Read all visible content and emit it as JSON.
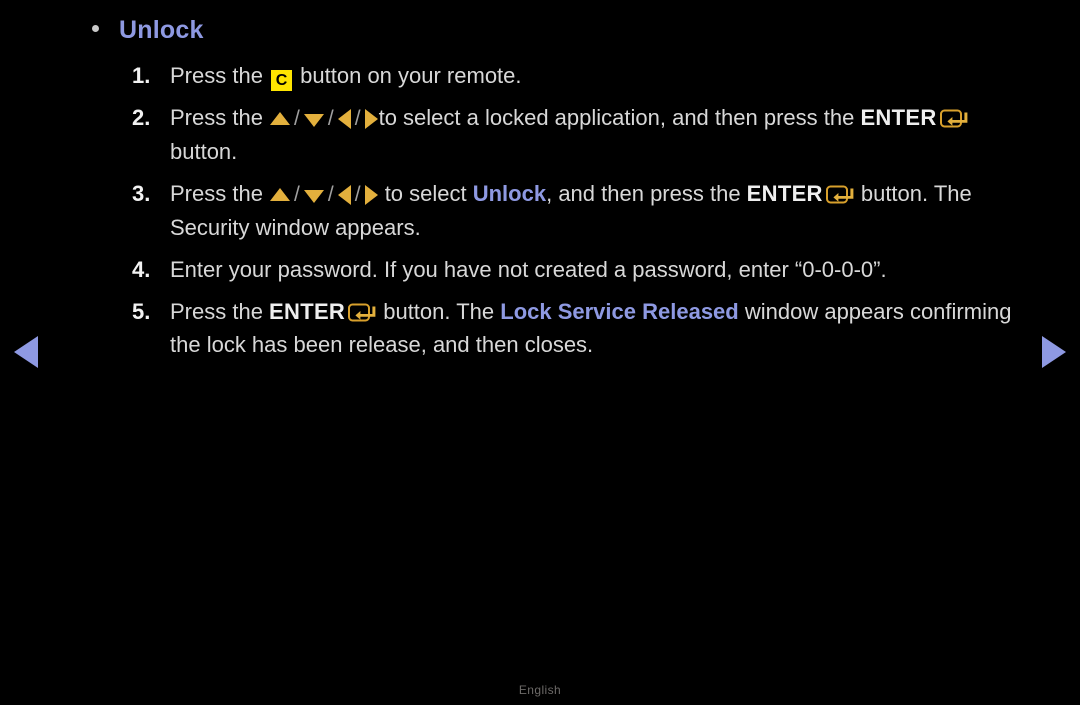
{
  "page": {
    "background_color": "#000000",
    "body_text_color": "#d8d8d8",
    "accent_blue": "#8e99e2",
    "accent_gold": "#e3b03d",
    "key_yellow": "#ffe500"
  },
  "heading": {
    "label": "Unlock",
    "bullet": "•"
  },
  "steps": [
    {
      "number": "1.",
      "parts": [
        {
          "type": "text",
          "value": "Press the "
        },
        {
          "type": "key",
          "value": "C"
        },
        {
          "type": "text",
          "value": " button on your remote."
        }
      ]
    },
    {
      "number": "2.",
      "parts": [
        {
          "type": "text",
          "value": "Press the "
        },
        {
          "type": "icon",
          "value": "arrow-up-icon"
        },
        {
          "type": "sep",
          "value": "/"
        },
        {
          "type": "icon",
          "value": "arrow-down-icon"
        },
        {
          "type": "sep",
          "value": "/"
        },
        {
          "type": "icon",
          "value": "arrow-left-icon"
        },
        {
          "type": "sep",
          "value": "/"
        },
        {
          "type": "icon",
          "value": "arrow-right-icon"
        },
        {
          "type": "text",
          "value": "to select a locked application, and then press the "
        },
        {
          "type": "bold",
          "value": "ENTER"
        },
        {
          "type": "icon",
          "value": "enter-key-icon"
        },
        {
          "type": "text",
          "value": " button."
        }
      ]
    },
    {
      "number": "3.",
      "parts": [
        {
          "type": "text",
          "value": "Press the "
        },
        {
          "type": "icon",
          "value": "arrow-up-icon"
        },
        {
          "type": "sep",
          "value": "/"
        },
        {
          "type": "icon",
          "value": "arrow-down-icon"
        },
        {
          "type": "sep",
          "value": "/"
        },
        {
          "type": "icon",
          "value": "arrow-left-icon"
        },
        {
          "type": "sep",
          "value": "/"
        },
        {
          "type": "icon",
          "value": "arrow-right-icon"
        },
        {
          "type": "text",
          "value": " to select "
        },
        {
          "type": "blue",
          "value": "Unlock"
        },
        {
          "type": "text",
          "value": ", and then press the "
        },
        {
          "type": "bold",
          "value": "ENTER"
        },
        {
          "type": "icon",
          "value": "enter-key-icon"
        },
        {
          "type": "text",
          "value": " button. The Security window appears."
        }
      ]
    },
    {
      "number": "4.",
      "parts": [
        {
          "type": "text",
          "value": "Enter your password. If you have not created a password, enter “0-0-0-0”."
        }
      ]
    },
    {
      "number": "5.",
      "parts": [
        {
          "type": "text",
          "value": "Press the "
        },
        {
          "type": "bold",
          "value": "ENTER"
        },
        {
          "type": "icon",
          "value": "enter-key-icon"
        },
        {
          "type": "text",
          "value": " button. The "
        },
        {
          "type": "blue",
          "value": "Lock Service Released"
        },
        {
          "type": "text",
          "value": " window appears confirming the lock has been release, and then closes."
        }
      ]
    }
  ],
  "nav": {
    "prev_icon": "arrow-left-nav-icon",
    "next_icon": "arrow-right-nav-icon"
  },
  "footer": {
    "language": "English"
  }
}
